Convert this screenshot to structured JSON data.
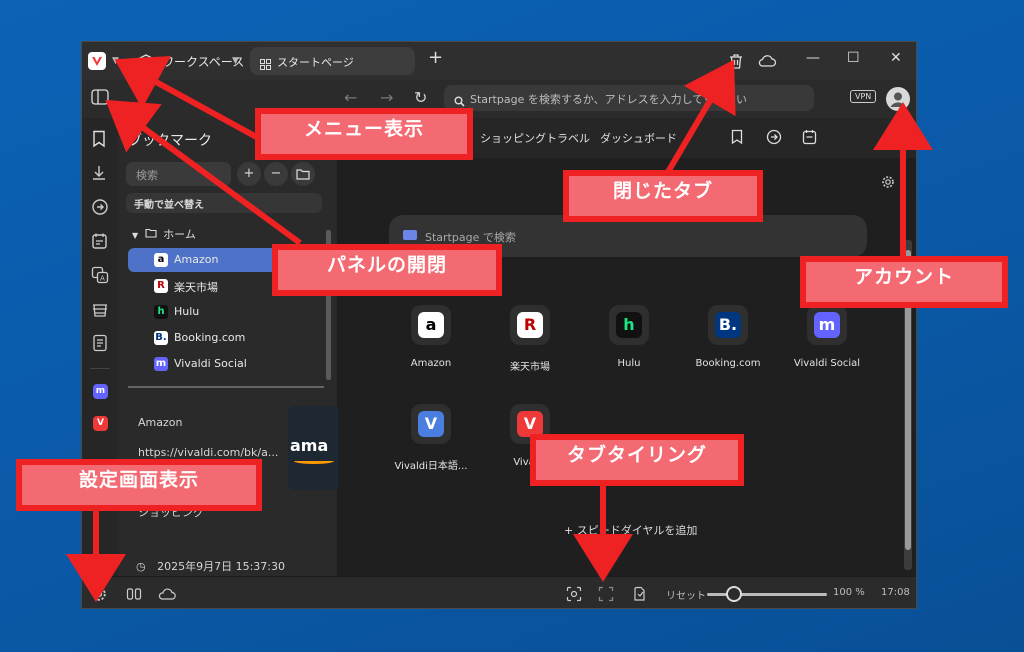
{
  "titlebar": {
    "workspace_label": "ワークスペース",
    "tab_label": "スタートページ",
    "new_tab": "+",
    "minimize": "—",
    "maximize": "☐",
    "close": "✕"
  },
  "addressbar": {
    "back": "←",
    "forward": "→",
    "reload": "↻",
    "placeholder": "Startpage を検索するか、アドレスを入力してください",
    "vpn": "VPN"
  },
  "bookmark_panel": {
    "title": "ブックマーク",
    "search_placeholder": "検索",
    "add": "+",
    "remove": "−",
    "sort_label": "手動で並べ替え",
    "home_folder": "ホーム",
    "items": [
      {
        "name": "Amazon",
        "icon": "a",
        "icon_bg": "#ffffff",
        "icon_fg": "#000000"
      },
      {
        "name": "楽天市場",
        "icon": "R",
        "icon_bg": "#ffffff",
        "icon_fg": "#bf0000"
      },
      {
        "name": "Hulu",
        "icon": "h",
        "icon_bg": "#111111",
        "icon_fg": "#1ce783"
      },
      {
        "name": "Booking.com",
        "icon": "B.",
        "icon_bg": "#ffffff",
        "icon_fg": "#003580"
      },
      {
        "name": "Vivaldi Social",
        "icon": "m",
        "icon_bg": "#6364ff",
        "icon_fg": "#ffffff"
      }
    ],
    "detail_title": "Amazon",
    "detail_url": "https://vivaldi.com/bk/a...",
    "detail_desc": "ショッピング",
    "detail_date": "2025年9月7日 15:37:30",
    "thumb_text": "ama"
  },
  "main": {
    "nav_links": [
      "ショッピング",
      "トラベル",
      "ダッシュボード"
    ],
    "search_placeholder": "Startpage で検索",
    "dials": [
      {
        "name": "Amazon",
        "icon": "a",
        "bg": "#ffffff",
        "fg": "#000000"
      },
      {
        "name": "楽天市場",
        "icon": "R",
        "bg": "#ffffff",
        "fg": "#bf0000"
      },
      {
        "name": "Hulu",
        "icon": "h",
        "bg": "#111111",
        "fg": "#1ce783"
      },
      {
        "name": "Booking.com",
        "icon": "B.",
        "bg": "#003580",
        "fg": "#ffffff"
      },
      {
        "name": "Vivaldi Social",
        "icon": "m",
        "bg": "#6364ff",
        "fg": "#ffffff"
      },
      {
        "name": "Vivaldi日本語...",
        "icon": "V",
        "bg": "#4a7fe0",
        "fg": "#ffffff"
      },
      {
        "name": "Vivaldi",
        "icon": "V",
        "bg": "#ef3939",
        "fg": "#ffffff"
      }
    ],
    "add_dial": "+ スピードダイヤルを追加"
  },
  "statusbar": {
    "reset": "リセット",
    "zoom": "100 %",
    "time": "17:08",
    "zoom_level_percent": 100
  },
  "annotations": {
    "menu": "メニュー表示",
    "panel": "パネルの開閉",
    "closed_tabs": "閉じたタブ",
    "account": "アカウント",
    "settings": "設定画面表示",
    "tiling": "タブタイリング"
  },
  "colors": {
    "background": "#0a5aa8",
    "callout_border": "#ee2222",
    "callout_fill": "#f36a72",
    "selection": "#4f72c9"
  }
}
